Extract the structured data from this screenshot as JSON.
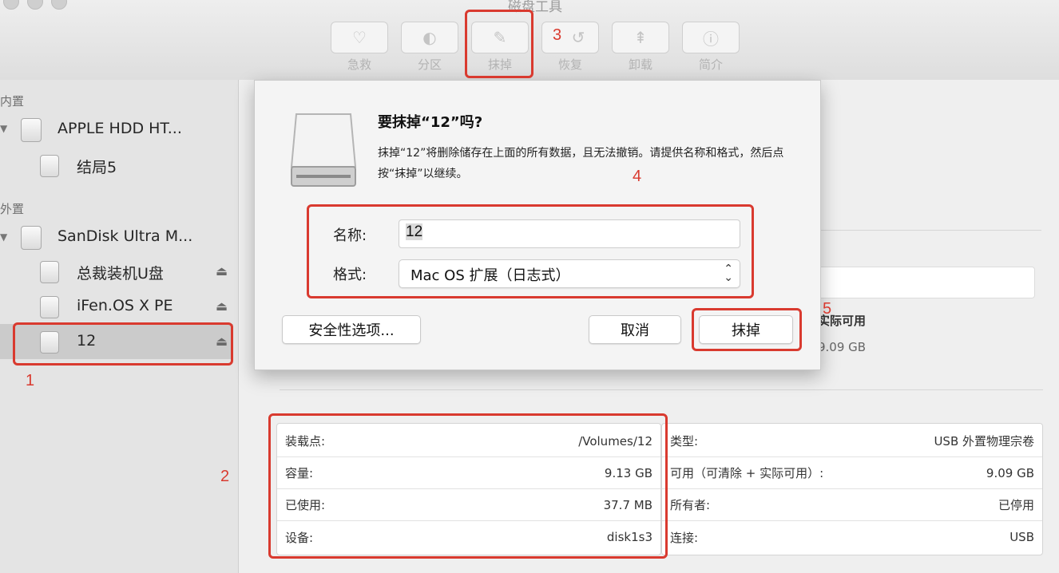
{
  "window": {
    "title": "磁盘工具"
  },
  "toolbar": {
    "buttons": [
      {
        "label": "急救",
        "icon": "stethoscope-icon"
      },
      {
        "label": "分区",
        "icon": "partition-icon"
      },
      {
        "label": "抹掉",
        "icon": "erase-icon"
      },
      {
        "label": "恢复",
        "icon": "restore-icon"
      },
      {
        "label": "卸载",
        "icon": "unmount-icon"
      },
      {
        "label": "简介",
        "icon": "info-icon"
      }
    ]
  },
  "sidebar": {
    "internal_header": "内置",
    "internal": [
      {
        "label": "APPLE HDD HT...",
        "icon": "hard-drive-icon"
      },
      {
        "label": "结局5",
        "icon": "volume-icon"
      }
    ],
    "external_header": "外置",
    "external": [
      {
        "label": "SanDisk Ultra M...",
        "icon": "usb-drive-icon"
      },
      {
        "label": "总裁装机U盘",
        "icon": "volume-icon",
        "eject": "⏏"
      },
      {
        "label": "iFen.OS X PE",
        "icon": "volume-icon",
        "eject": "⏏"
      },
      {
        "label": "12",
        "icon": "volume-icon",
        "eject": "⏏",
        "selected": true
      }
    ]
  },
  "dialog": {
    "title": "要抹掉“12”吗?",
    "message": "抹掉“12”将删除储存在上面的所有数据，且无法撤销。请提供名称和格式，然后点按“抹掉”以继续。",
    "name_label": "名称:",
    "name_value": "12",
    "format_label": "格式:",
    "format_value": "Mac OS 扩展（日志式）",
    "security_button": "安全性选项...",
    "cancel_button": "取消",
    "erase_button": "抹掉"
  },
  "background": {
    "avail_label": "实际可用",
    "avail_value": "9.09 GB"
  },
  "info": {
    "left": [
      {
        "label": "装载点:",
        "value": "/Volumes/12"
      },
      {
        "label": "容量:",
        "value": "9.13 GB"
      },
      {
        "label": "已使用:",
        "value": "37.7 MB"
      },
      {
        "label": "设备:",
        "value": "disk1s3"
      }
    ],
    "right": [
      {
        "label": "类型:",
        "value": "USB 外置物理宗卷"
      },
      {
        "label": "可用（可清除 + 实际可用）:",
        "value": "9.09 GB"
      },
      {
        "label": "所有者:",
        "value": "已停用"
      },
      {
        "label": "连接:",
        "value": "USB"
      }
    ]
  },
  "annotations": [
    "1",
    "2",
    "3",
    "4",
    "5"
  ],
  "colors": {
    "annotation_red": "#d93a2f"
  }
}
